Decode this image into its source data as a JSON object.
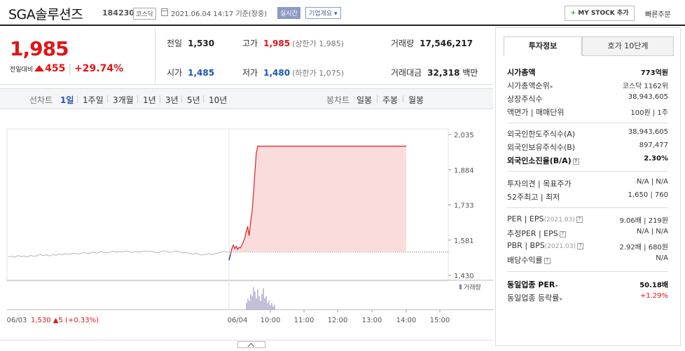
{
  "header": {
    "company_name": "SGA솔루션즈",
    "code": "184230",
    "market": "코스닥",
    "datetime": "2021.06.04 14:17",
    "basis": "기준(장중)",
    "live_badge": "실시간",
    "overview_label": "기업개요",
    "mystock_label": "MY STOCK 추가",
    "quick_order": "빠른주문"
  },
  "summary": {
    "price": "1,985",
    "change_label": "전일대비",
    "change_amount": "455",
    "change_pct": "+29.74%",
    "prev_label": "전일",
    "prev_value": "1,530",
    "high_label": "고가",
    "high_value": "1,985",
    "high_note": "(상한가 1,985)",
    "volume_label": "거래량",
    "volume_value": "17,546,217",
    "open_label": "시가",
    "open_value": "1,485",
    "low_label": "저가",
    "low_value": "1,480",
    "low_note": "(하한가 1,075)",
    "amount_label": "거래대금",
    "amount_value": "32,318",
    "amount_unit": "백만"
  },
  "tabs": {
    "line_label": "선차트",
    "periods": [
      "1일",
      "1주일",
      "3개월",
      "1년",
      "3년",
      "5년",
      "10년"
    ],
    "candle_label": "봉차트",
    "candles": [
      "일봉",
      "주봉",
      "월봉"
    ]
  },
  "chart_data": {
    "type": "line",
    "title": "",
    "y_ticks": [
      "2,035",
      "1,884",
      "1,733",
      "1,581",
      "1,430"
    ],
    "ylim": [
      1430,
      2035
    ],
    "x_labels": [
      "06/03",
      "06/04",
      "10:00",
      "11:00",
      "12:00",
      "13:00",
      "14:00",
      "15:00"
    ],
    "prev_close": 1530,
    "prev_day_label": "06/03",
    "prev_day_close": "1,530",
    "prev_day_change": "5",
    "prev_day_pct": "(+0.33%)",
    "volume_label": "거래량",
    "prev_series": [
      1510,
      1512,
      1508,
      1515,
      1511,
      1513,
      1509,
      1516,
      1512,
      1514,
      1520,
      1515,
      1518,
      1513,
      1519,
      1516,
      1522,
      1518,
      1524,
      1519,
      1523,
      1526,
      1521,
      1525,
      1528,
      1522,
      1527,
      1530,
      1525,
      1532,
      1528,
      1526,
      1530,
      1534,
      1529,
      1533,
      1530,
      1535,
      1531,
      1528,
      1533,
      1529,
      1532,
      1536,
      1531,
      1534,
      1530,
      1527,
      1532,
      1536,
      1530,
      1528,
      1533,
      1535,
      1530,
      1526,
      1529,
      1524,
      1521,
      1525,
      1520,
      1517,
      1520,
      1523,
      1519,
      1522,
      1526,
      1530,
      1533,
      1530
    ],
    "today_series": [
      1495,
      1520,
      1545,
      1560,
      1545,
      1555,
      1542,
      1550,
      1548,
      1560,
      1575,
      1590,
      1620,
      1640,
      1600,
      1660,
      1700,
      1780,
      1870,
      1955,
      1985,
      1985,
      1985
    ],
    "volume_bars": [
      0.3,
      0.5,
      0.4,
      0.7,
      0.6,
      1.0,
      0.8,
      0.5,
      0.9,
      0.6,
      0.4,
      0.7,
      0.95,
      0.5,
      0.6,
      0.3,
      0.4,
      0.2,
      0.3,
      0.15,
      0.2
    ]
  },
  "panel": {
    "tab_info": "투자정보",
    "tab_quote": "호가 10단계",
    "market_cap_label": "시가총액",
    "market_cap_value": "773억원",
    "cap_rank_label": "시가총액순위",
    "cap_rank_value": "코스닥 1162위",
    "shares_label": "상장주식수",
    "shares_value": "38,943,605",
    "face_label": "액면가 | 매매단위",
    "face_value": "100원 | 1주",
    "foreign_limit_label": "외국인한도주식수(A)",
    "foreign_limit_value": "38,943,605",
    "foreign_hold_label": "외국인보유주식수(B)",
    "foreign_hold_value": "897,477",
    "foreign_ratio_label": "외국인소진율(B/A)",
    "foreign_ratio_value": "2.30%",
    "opinion_label": "투자의견 | 목표주가",
    "opinion_value": "N/A | N/A",
    "wk52_label": "52주최고 | 최저",
    "wk52_value": "1,650 | 760",
    "per_label": "PER | EPS",
    "per_period": "(2021.03)",
    "per_value": "9.06배 | 219원",
    "est_per_label": "추정PER | EPS",
    "est_per_value": "N/A | N/A",
    "pbr_label": "PBR | BPS",
    "pbr_period": "(2021.03)",
    "pbr_value": "2.92배 | 680원",
    "div_label": "배당수익률",
    "div_value": "N/A",
    "sector_per_label": "동일업종 PER",
    "sector_per_value": "50.18배",
    "sector_rate_label": "동일업종 등락률",
    "sector_rate_value": "+1.29%"
  },
  "colors": {
    "up": "#e01515",
    "down": "#1a55b5",
    "accent": "#2b55a6"
  }
}
